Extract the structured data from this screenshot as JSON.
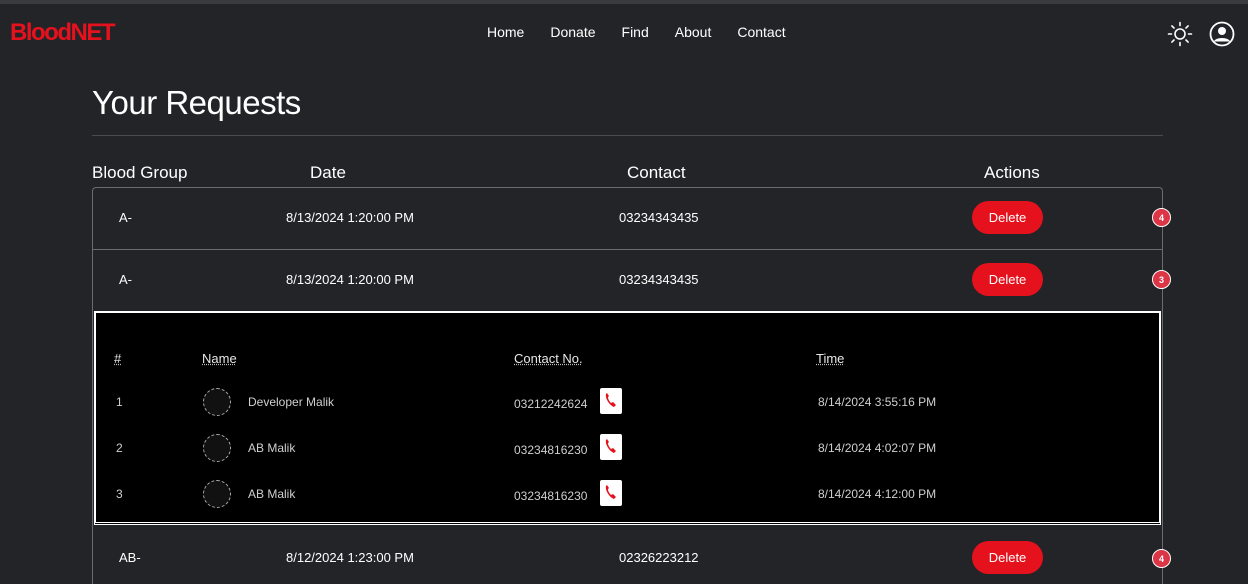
{
  "brand": {
    "name": "BloodNET",
    "color": "#e5121d"
  },
  "nav": {
    "items": [
      {
        "label": "Home"
      },
      {
        "label": "Donate"
      },
      {
        "label": "Find"
      },
      {
        "label": "About"
      },
      {
        "label": "Contact"
      }
    ]
  },
  "header_icons": {
    "theme": "sun-icon",
    "profile": "user-circle-icon"
  },
  "page": {
    "title": "Your Requests"
  },
  "table": {
    "columns": [
      "Blood Group",
      "Date",
      "Contact",
      "Actions"
    ],
    "rows": [
      {
        "blood_group": "A-",
        "date": "8/13/2024 1:20:00 PM",
        "contact": "03234343435",
        "action": "Delete",
        "badge": "4"
      },
      {
        "blood_group": "A-",
        "date": "8/13/2024 1:20:00 PM",
        "contact": "03234343435",
        "action": "Delete",
        "badge": "3"
      },
      {
        "blood_group": "AB-",
        "date": "8/12/2024 1:23:00 PM",
        "contact": "02326223212",
        "action": "Delete",
        "badge": "4"
      }
    ]
  },
  "responses": {
    "columns": [
      "#",
      "Name",
      "Contact No.",
      "Time"
    ],
    "rows": [
      {
        "index": "1",
        "name": "Developer Malik",
        "contact": "03212242624",
        "time": "8/14/2024 3:55:16 PM"
      },
      {
        "index": "2",
        "name": "AB Malik",
        "contact": "03234816230",
        "time": "8/14/2024 4:02:07 PM"
      },
      {
        "index": "3",
        "name": "AB Malik",
        "contact": "03234816230",
        "time": "8/14/2024 4:12:00 PM"
      }
    ]
  },
  "colors": {
    "accent": "#e5121d",
    "background": "#232428",
    "badge": "#dc3545"
  }
}
